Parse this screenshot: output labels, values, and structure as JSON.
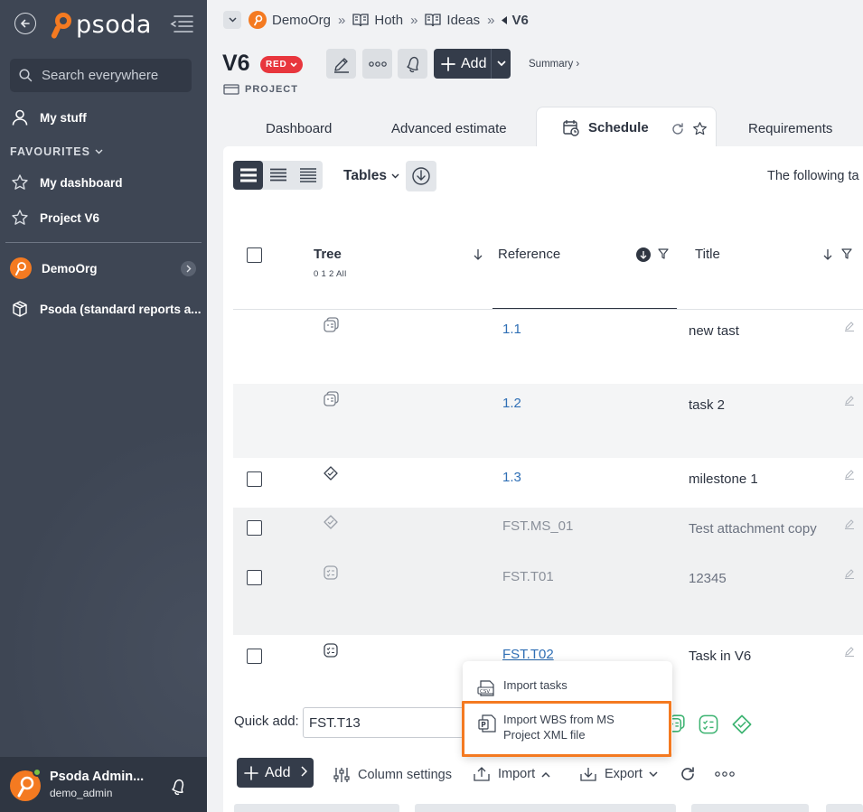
{
  "sidebar": {
    "brand": "psoda",
    "search_placeholder": "Search everywhere",
    "my_stuff": "My stuff",
    "favourites_heading": "FAVOURITES",
    "favourites": [
      {
        "label": "My dashboard",
        "icon": "star-icon"
      },
      {
        "label": "Project V6",
        "icon": "star-icon"
      }
    ],
    "org": "DemoOrg",
    "library": "Psoda (standard reports a...",
    "user_name": "Psoda Admin...",
    "user_handle": "demo_admin",
    "accent_color": "#f47a21"
  },
  "breadcrumbs": {
    "items": [
      "DemoOrg",
      "Hoth",
      "Ideas"
    ],
    "current": "V6"
  },
  "header": {
    "title": "V6",
    "rag_status": "RED",
    "rag_color": "#e8363d",
    "add_label": "Add",
    "summary_link": "Summary ›",
    "type_label": "PROJECT"
  },
  "tabs": {
    "dashboard": "Dashboard",
    "advanced_estimate": "Advanced estimate",
    "schedule": "Schedule",
    "requirements": "Requirements"
  },
  "toolbar": {
    "tables_label": "Tables",
    "following_text": "The following ta"
  },
  "table": {
    "columns": {
      "tree": "Tree",
      "tree_levels": "0 1 2 All",
      "reference": "Reference",
      "title": "Title"
    },
    "rows": [
      {
        "ref": "1.1",
        "title": "new tast",
        "type": "summary-task-icon"
      },
      {
        "ref": "1.2",
        "title": "task 2",
        "type": "summary-task-icon"
      },
      {
        "ref": "1.3",
        "title": "milestone 1",
        "type": "milestone-icon"
      },
      {
        "ref": "FST.MS_01",
        "title": "Test attachment copy",
        "type": "milestone-icon"
      },
      {
        "ref": "FST.T01",
        "title": "12345",
        "type": "task-icon"
      },
      {
        "ref": "FST.T02",
        "title": "Task in V6",
        "type": "task-icon"
      }
    ]
  },
  "quick_add": {
    "label": "Quick add:",
    "value": "FST.T13"
  },
  "bottom": {
    "add_label": "Add",
    "column_settings": "Column settings",
    "import_label": "Import",
    "export_label": "Export"
  },
  "import_menu": {
    "items": [
      "Import tasks",
      "Import WBS from MS Project XML file"
    ],
    "wbs_line1": "Import WBS from MS",
    "wbs_line2": "Project XML file",
    "highlight_color": "#f47a21"
  }
}
